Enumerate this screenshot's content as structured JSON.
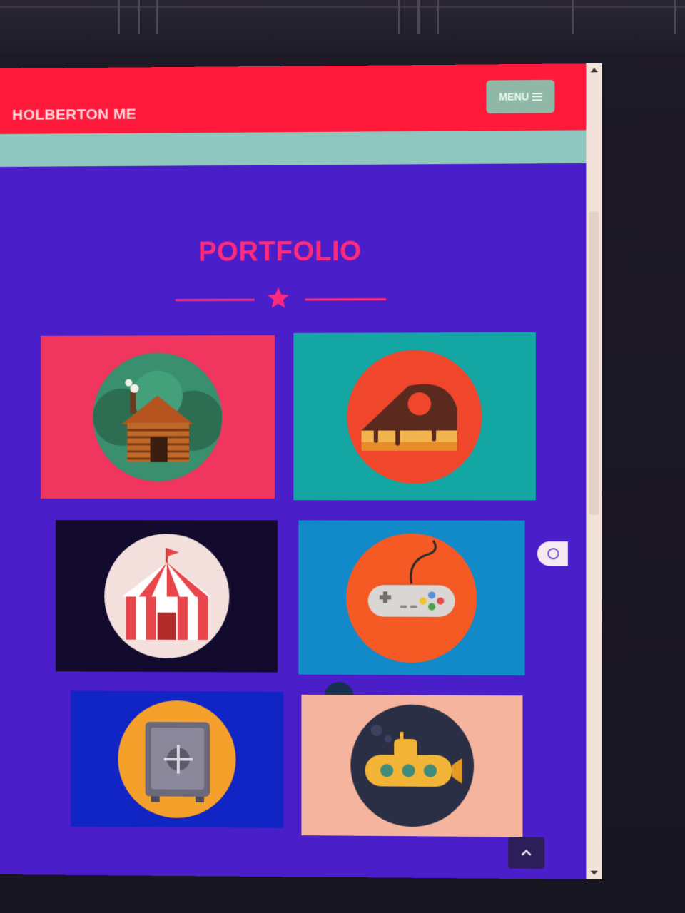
{
  "header": {
    "brand": "HOLBERTON ME",
    "menu_label": "MENU"
  },
  "portfolio": {
    "title": "PORTFOLIO",
    "items": [
      {
        "name": "cabin",
        "icon": "log-cabin-icon",
        "tile_color": "#f0355f",
        "circle_color": "#3a8f6e"
      },
      {
        "name": "cake",
        "icon": "cake-slice-icon",
        "tile_color": "#14a6a3",
        "circle_color": "#f0462b"
      },
      {
        "name": "circus",
        "icon": "circus-tent-icon",
        "tile_color": "#120b2e",
        "circle_color": "#f3dfdc"
      },
      {
        "name": "game",
        "icon": "game-controller-icon",
        "tile_color": "#1289c9",
        "circle_color": "#f55a24"
      },
      {
        "name": "safe",
        "icon": "safe-icon",
        "tile_color": "#1124c4",
        "circle_color": "#f5a02a"
      },
      {
        "name": "submarine",
        "icon": "submarine-icon",
        "tile_color": "#f5b49d",
        "circle_color": "#2b2f45"
      }
    ]
  },
  "colors": {
    "header": "#ff1a3c",
    "accent": "#ff2a7a",
    "page_bg": "#4a1ec9",
    "teal_strip": "#8fc7bf"
  }
}
